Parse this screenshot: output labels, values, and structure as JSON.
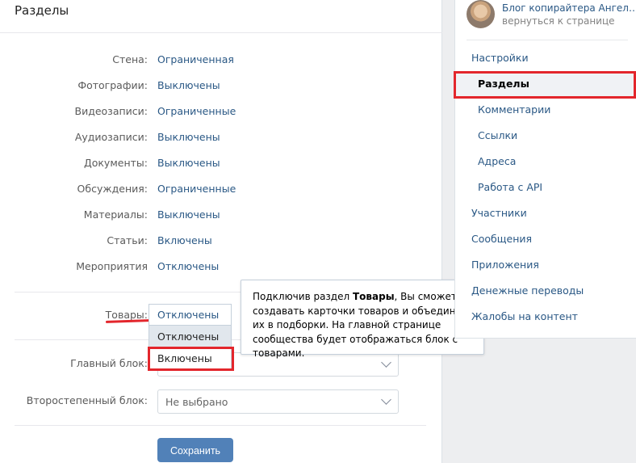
{
  "main": {
    "title": "Разделы",
    "rows": [
      {
        "label": "Стена:",
        "value": "Ограниченная"
      },
      {
        "label": "Фотографии:",
        "value": "Выключены"
      },
      {
        "label": "Видеозаписи:",
        "value": "Ограниченные"
      },
      {
        "label": "Аудиозаписи:",
        "value": "Выключены"
      },
      {
        "label": "Документы:",
        "value": "Выключены"
      },
      {
        "label": "Обсуждения:",
        "value": "Ограниченные"
      },
      {
        "label": "Материалы:",
        "value": "Выключены"
      },
      {
        "label": "Статьи:",
        "value": "Включены"
      },
      {
        "label": "Мероприятия",
        "value": "Отключены"
      }
    ],
    "goods": {
      "label": "Товары:",
      "current": "Отключены",
      "options": [
        "Отключены",
        "Включены"
      ]
    },
    "main_block": {
      "label": "Главный блок:"
    },
    "secondary_block": {
      "label": "Второстепенный блок:",
      "value": "Не выбрано"
    },
    "save_label": "Сохранить",
    "tooltip": {
      "part1": "Подключив раздел ",
      "bold": "Товары",
      "part2": ", Вы сможете создавать карточки товаров и объединять их в подборки. На главной странице сообщества будет отображаться блок с товарами."
    }
  },
  "sidebar": {
    "group_name": "Блог копирайтера Ангел…",
    "back_link": "вернуться к странице",
    "items": [
      {
        "label": "Настройки"
      },
      {
        "label": "Разделы"
      },
      {
        "label": "Комментарии"
      },
      {
        "label": "Ссылки"
      },
      {
        "label": "Адреса"
      },
      {
        "label": "Работа с API"
      },
      {
        "label": "Участники"
      },
      {
        "label": "Сообщения"
      },
      {
        "label": "Приложения"
      },
      {
        "label": "Денежные переводы"
      },
      {
        "label": "Жалобы на контент"
      }
    ]
  },
  "colors": {
    "accent": "#5181b8",
    "link": "#2a5885",
    "highlight_red": "#e3262c"
  }
}
